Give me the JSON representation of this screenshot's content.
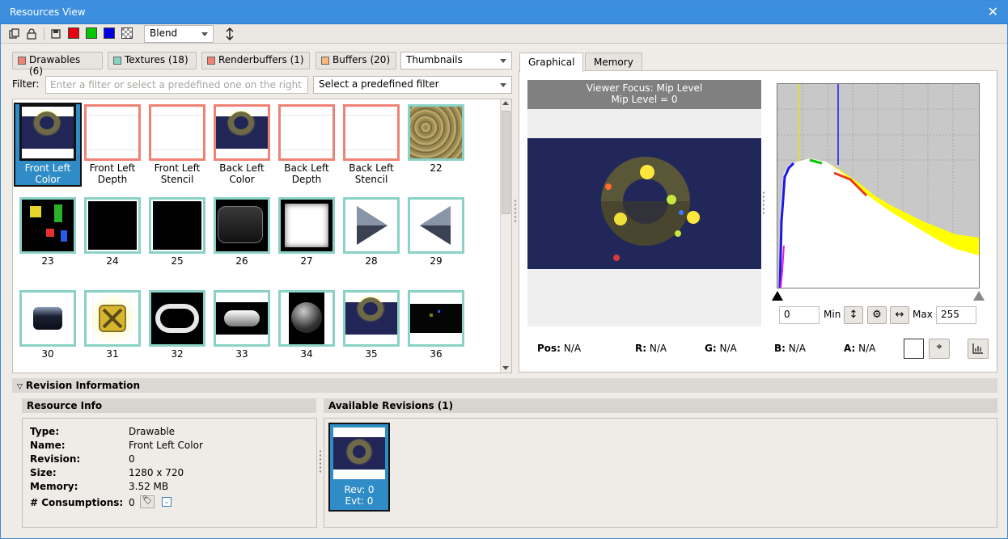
{
  "window": {
    "title": "Resources View",
    "close": "✕"
  },
  "toolbar": {
    "blend_value": "Blend",
    "swatches": [
      "#e8000f",
      "#00c800",
      "#0000e0"
    ]
  },
  "categories": [
    {
      "label": "Drawables (6)",
      "color": "#ef8275"
    },
    {
      "label": "Textures (18)",
      "color": "#8ad2c6"
    },
    {
      "label": "Renderbuffers (1)",
      "color": "#ef8275"
    },
    {
      "label": "Buffers (20)",
      "color": "#f5b878"
    }
  ],
  "view_mode": "Thumbnails",
  "filter": {
    "label": "Filter:",
    "placeholder": "Enter a filter or select a predefined one on the right",
    "predefined": "Select a predefined filter"
  },
  "resources": [
    {
      "label": "Front Left Color",
      "kind": "drawable",
      "thumb": "scene",
      "selected": true
    },
    {
      "label": "Front Left Depth",
      "kind": "drawable",
      "thumb": "white"
    },
    {
      "label": "Front Left Stencil",
      "kind": "drawable",
      "thumb": "white"
    },
    {
      "label": "Back Left Color",
      "kind": "drawable",
      "thumb": "scene"
    },
    {
      "label": "Back Left Depth",
      "kind": "drawable",
      "thumb": "white"
    },
    {
      "label": "Back Left Stencil",
      "kind": "drawable",
      "thumb": "white"
    },
    {
      "label": "22",
      "kind": "texture",
      "thumb": "rock"
    },
    {
      "label": "23",
      "kind": "texture",
      "thumb": "noise"
    },
    {
      "label": "24",
      "kind": "texture",
      "thumb": "black"
    },
    {
      "label": "25",
      "kind": "texture",
      "thumb": "black"
    },
    {
      "label": "26",
      "kind": "texture",
      "thumb": "panel"
    },
    {
      "label": "27",
      "kind": "texture",
      "thumb": "frame"
    },
    {
      "label": "28",
      "kind": "texture",
      "thumb": "right"
    },
    {
      "label": "29",
      "kind": "texture",
      "thumb": "left"
    },
    {
      "label": "30",
      "kind": "texture",
      "thumb": "button"
    },
    {
      "label": "31",
      "kind": "texture",
      "thumb": "xbox"
    },
    {
      "label": "32",
      "kind": "texture",
      "thumb": "oval"
    },
    {
      "label": "33",
      "kind": "texture",
      "thumb": "pill"
    },
    {
      "label": "34",
      "kind": "texture",
      "thumb": "sphere"
    },
    {
      "label": "35",
      "kind": "texture",
      "thumb": "scene"
    },
    {
      "label": "36",
      "kind": "texture",
      "thumb": "dark"
    }
  ],
  "tabs": [
    "Graphical",
    "Memory"
  ],
  "viewer": {
    "focus_line1": "Viewer Focus: Mip Level",
    "focus_line2": "Mip Level = 0"
  },
  "histogram": {
    "min": "0",
    "min_label": "Min",
    "max": "255",
    "max_label": "Max"
  },
  "pixel": {
    "pos_label": "Pos:",
    "pos": "N/A",
    "r_label": "R:",
    "r": "N/A",
    "g_label": "G:",
    "g": "N/A",
    "b_label": "B:",
    "b": "N/A",
    "a_label": "A:",
    "a": "N/A"
  },
  "revision": {
    "header": "Revision Information",
    "info_header": "Resource Info",
    "available_header": "Available Revisions (1)",
    "fields": [
      {
        "key": "Type:",
        "value": "Drawable"
      },
      {
        "key": "Name:",
        "value": "Front Left Color"
      },
      {
        "key": "Revision:",
        "value": "0"
      },
      {
        "key": "Size:",
        "value": "1280 x 720"
      },
      {
        "key": "Memory:",
        "value": "3.52 MB"
      },
      {
        "key": "# Consumptions:",
        "value": "0"
      }
    ],
    "items": [
      {
        "rev": "Rev: 0",
        "evt": "Evt: 0"
      }
    ]
  }
}
